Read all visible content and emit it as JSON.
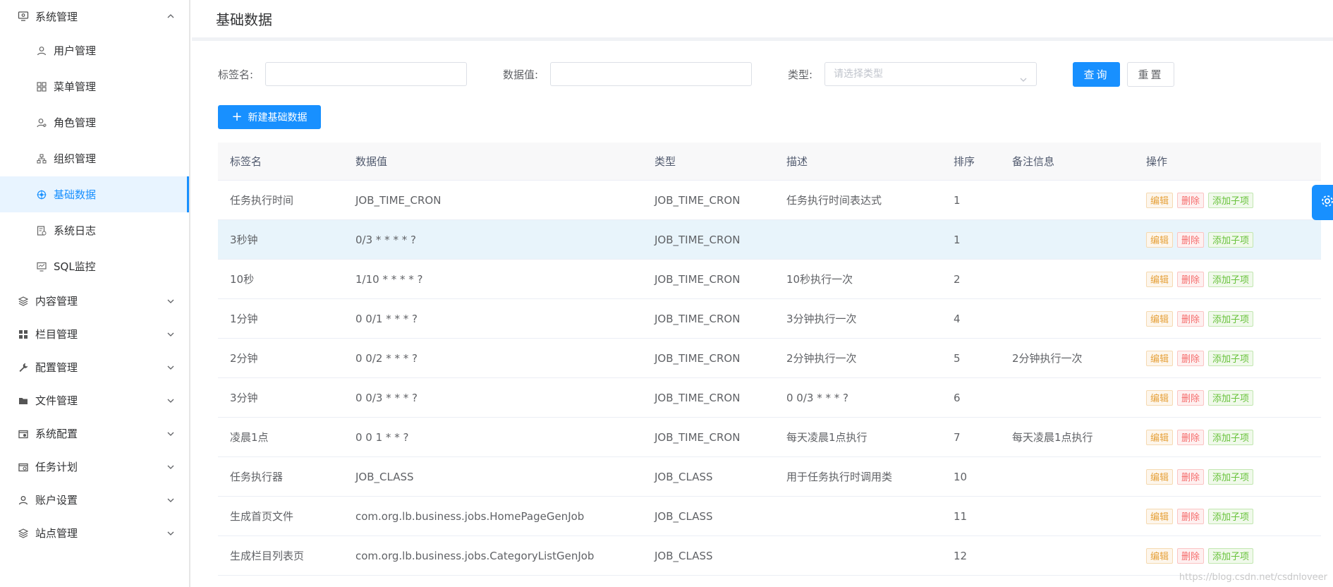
{
  "sidebar": {
    "system": {
      "label": "系统管理"
    },
    "subitems": [
      {
        "label": "用户管理",
        "icon": "user-icon"
      },
      {
        "label": "菜单管理",
        "icon": "grid-icon"
      },
      {
        "label": "角色管理",
        "icon": "role-icon"
      },
      {
        "label": "组织管理",
        "icon": "org-icon"
      },
      {
        "label": "基础数据",
        "icon": "data-icon",
        "active": true
      },
      {
        "label": "系统日志",
        "icon": "log-icon"
      },
      {
        "label": "SQL监控",
        "icon": "monitor-icon"
      }
    ],
    "groups": [
      {
        "label": "内容管理",
        "icon": "layers-icon"
      },
      {
        "label": "栏目管理",
        "icon": "apps-icon"
      },
      {
        "label": "配置管理",
        "icon": "wrench-icon"
      },
      {
        "label": "文件管理",
        "icon": "folder-icon"
      },
      {
        "label": "系统配置",
        "icon": "config-icon"
      },
      {
        "label": "任务计划",
        "icon": "task-icon"
      },
      {
        "label": "账户设置",
        "icon": "account-icon"
      },
      {
        "label": "站点管理",
        "icon": "site-icon"
      }
    ]
  },
  "page": {
    "title": "基础数据"
  },
  "filters": {
    "label_name": "标签名:",
    "data_value": "数据值:",
    "type": "类型:",
    "type_placeholder": "请选择类型",
    "query": "查询",
    "reset": "重置"
  },
  "actions": {
    "new": "新建基础数据"
  },
  "table": {
    "headers": [
      "标签名",
      "数据值",
      "类型",
      "描述",
      "排序",
      "备注信息",
      "操作"
    ],
    "ops": {
      "edit": "编辑",
      "delete": "删除",
      "add_child": "添加子项"
    },
    "rows": [
      [
        "任务执行时间",
        "JOB_TIME_CRON",
        "JOB_TIME_CRON",
        "任务执行时间表达式",
        "1",
        ""
      ],
      [
        "3秒钟",
        "0/3 * * * * ?",
        "JOB_TIME_CRON",
        "",
        "1",
        ""
      ],
      [
        "10秒",
        "1/10 * * * * ?",
        "JOB_TIME_CRON",
        "10秒执行一次",
        "2",
        ""
      ],
      [
        "1分钟",
        "0 0/1 * * * ?",
        "JOB_TIME_CRON",
        "3分钟执行一次",
        "4",
        ""
      ],
      [
        "2分钟",
        "0 0/2 * * * ?",
        "JOB_TIME_CRON",
        "2分钟执行一次",
        "5",
        "2分钟执行一次"
      ],
      [
        "3分钟",
        "0 0/3 * * * ?",
        "JOB_TIME_CRON",
        "0 0/3 * * * ?",
        "6",
        ""
      ],
      [
        "凌晨1点",
        "0 0 1 * * ?",
        "JOB_TIME_CRON",
        "每天凌晨1点执行",
        "7",
        "每天凌晨1点执行"
      ],
      [
        "任务执行器",
        "JOB_CLASS",
        "JOB_CLASS",
        "用于任务执行时调用类",
        "10",
        ""
      ],
      [
        "生成首页文件",
        "com.org.lb.business.jobs.HomePageGenJob",
        "JOB_CLASS",
        "",
        "11",
        ""
      ],
      [
        "生成栏目列表页",
        "com.org.lb.business.jobs.CategoryListGenJob",
        "JOB_CLASS",
        "",
        "12",
        ""
      ]
    ]
  },
  "watermark": "https://blog.csdn.net/csdnloveer",
  "colors": {
    "primary": "#1890ff",
    "edit": "#e6a23c",
    "delete": "#f56c6c",
    "add": "#67c23a",
    "highlight_row": "#e8f4fb"
  }
}
